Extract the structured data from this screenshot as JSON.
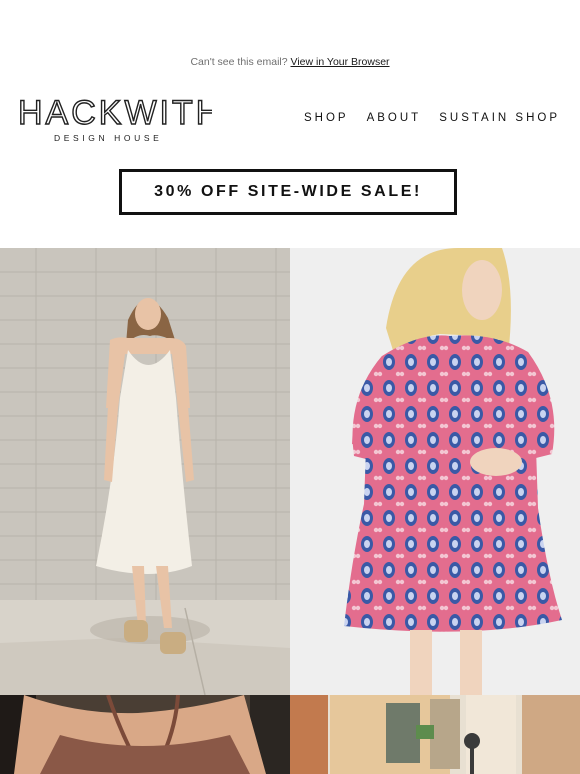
{
  "preheader": {
    "text": "Can't see this email?",
    "link": "View in Your Browser"
  },
  "brand": {
    "name": "HACKWITH",
    "subtitle": "DESIGN HOUSE"
  },
  "nav": {
    "items": [
      "SHOP",
      "ABOUT",
      "SUSTAIN SHOP"
    ]
  },
  "banner": {
    "label": "30% OFF SITE-WIDE SALE!"
  },
  "images": [
    {
      "icon": "white-dress-photo"
    },
    {
      "icon": "floral-dress-photo"
    },
    {
      "icon": "brown-top-photo"
    },
    {
      "icon": "street-photo"
    }
  ],
  "colors": {
    "text": "#111111",
    "muted": "#6f6f6f",
    "floral_pink": "#e36d8e",
    "floral_blue": "#3a59a6"
  }
}
